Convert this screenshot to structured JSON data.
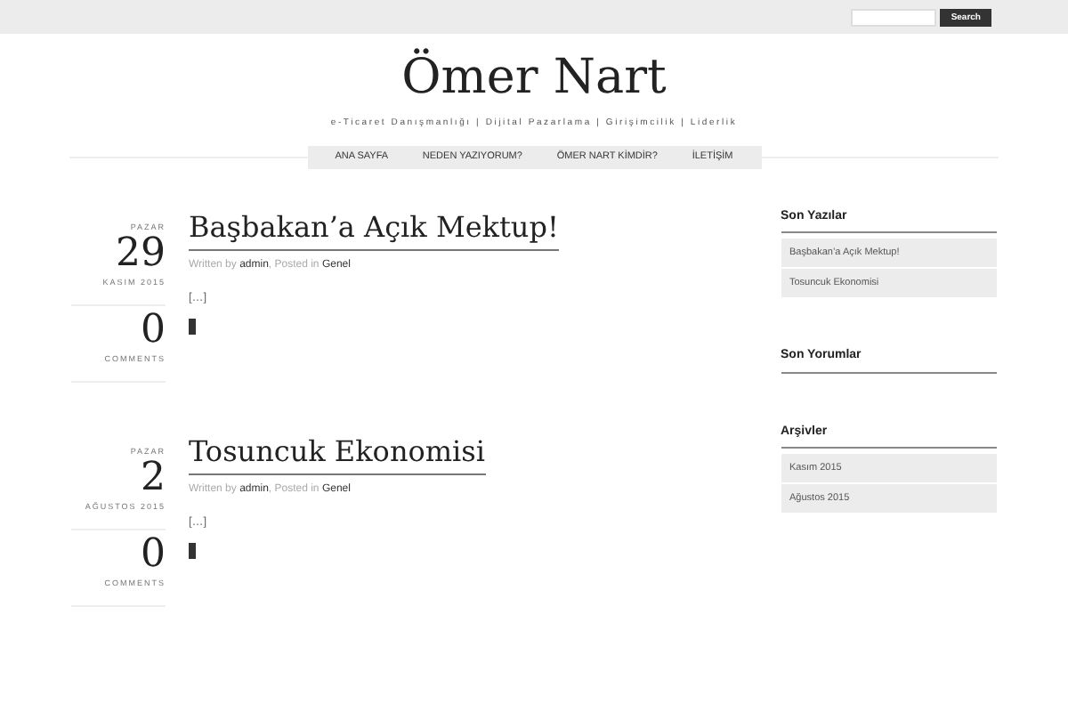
{
  "search": {
    "button": "Search"
  },
  "site": {
    "title": "Ömer Nart",
    "tagline": "e-Ticaret Danışmanlığı | Dijital Pazarlama | Girişimcilik | Liderlik"
  },
  "nav": [
    "ANA SAYFA",
    "NEDEN YAZIYORUM?",
    "ÖMER NART KİMDİR?",
    "İLETİŞİM"
  ],
  "posts": [
    {
      "weekday": "PAZAR",
      "day": "29",
      "month_year": "KASIM 2015",
      "comments": "0",
      "comments_label": "COMMENTS",
      "title": "Başbakan’a Açık Mektup!",
      "byline_prefix": "Written by",
      "author": "admin",
      "category_prefix": ", Posted in",
      "category": "Genel",
      "excerpt": "[…]"
    },
    {
      "weekday": "PAZAR",
      "day": "2",
      "month_year": "AĞUSTOS 2015",
      "comments": "0",
      "comments_label": "COMMENTS",
      "title": "Tosuncuk Ekonomisi",
      "byline_prefix": "Written by",
      "author": "admin",
      "category_prefix": ", Posted in",
      "category": "Genel",
      "excerpt": "[…]"
    }
  ],
  "sidebar": [
    {
      "title": "Son Yazılar",
      "items": [
        "Başbakan’a Açık Mektup!",
        "Tosuncuk Ekonomisi"
      ]
    },
    {
      "title": "Son Yorumlar"
    },
    {
      "title": "Arşivler",
      "items": [
        "Kasım 2015",
        "Ağustos 2015"
      ]
    }
  ]
}
